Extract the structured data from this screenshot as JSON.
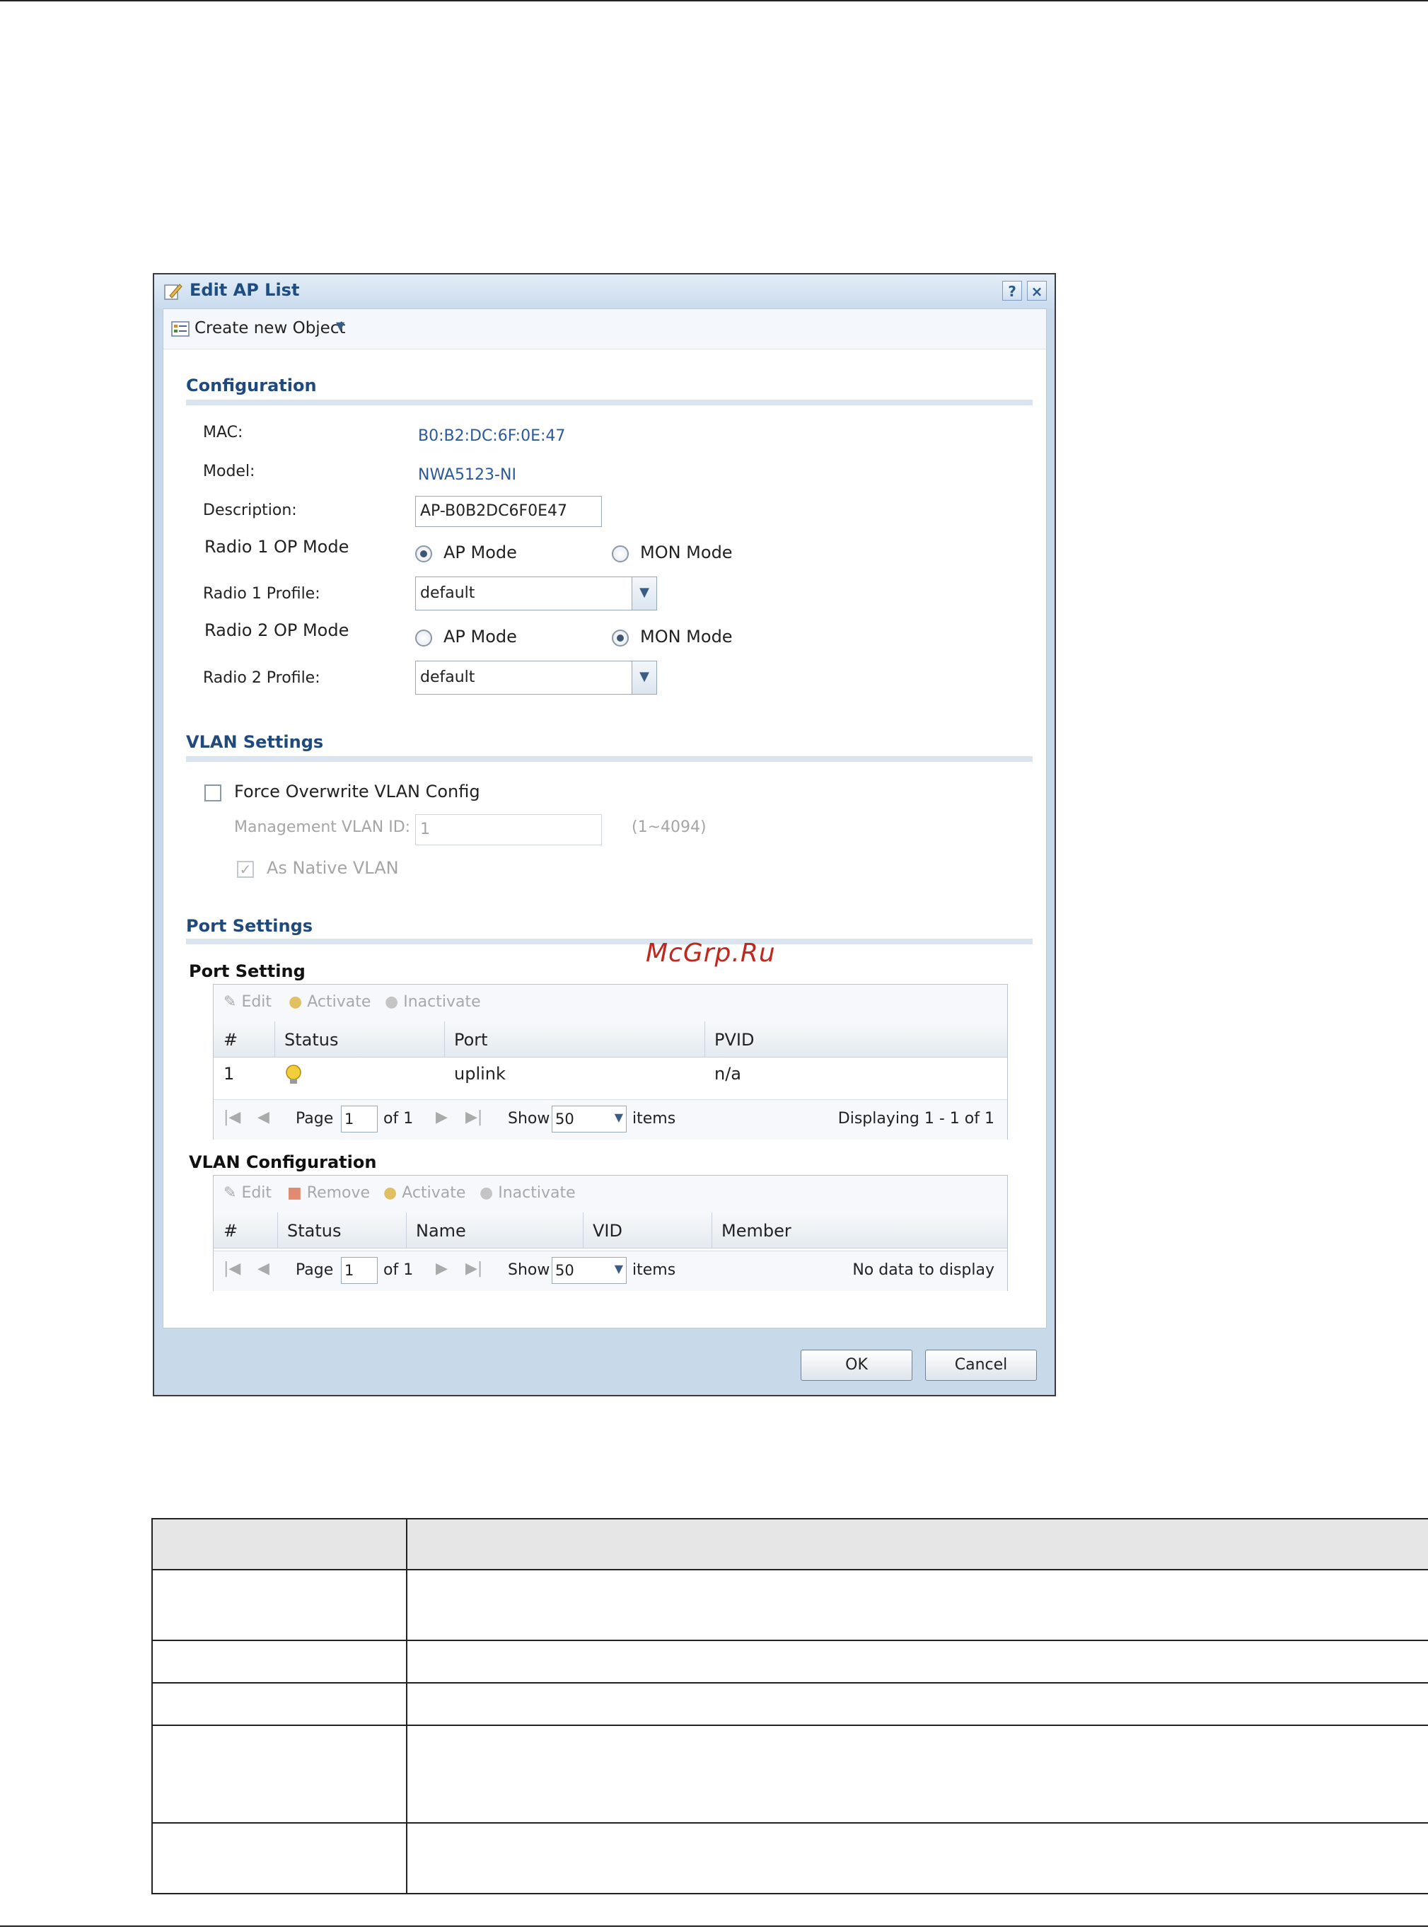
{
  "dialog": {
    "title": "Edit AP List",
    "help_label": "?",
    "close_label": "×",
    "toolbar": {
      "create_label": "Create new Object"
    },
    "configuration": {
      "heading": "Configuration",
      "mac_label": "MAC:",
      "mac_value": "B0:B2:DC:6F:0E:47",
      "model_label": "Model:",
      "model_value": "NWA5123-NI",
      "description_label": "Description:",
      "description_value": "AP-B0B2DC6F0E47",
      "radio1_mode_label": "Radio 1 OP Mode",
      "radio1_mode_ap": "AP Mode",
      "radio1_mode_mon": "MON Mode",
      "radio1_selected": "AP Mode",
      "radio1_profile_label": "Radio 1 Profile:",
      "radio1_profile_value": "default",
      "radio2_mode_label": "Radio 2 OP Mode",
      "radio2_mode_ap": "AP Mode",
      "radio2_mode_mon": "MON Mode",
      "radio2_selected": "MON Mode",
      "radio2_profile_label": "Radio 2 Profile:",
      "radio2_profile_value": "default"
    },
    "vlan_settings": {
      "heading": "VLAN Settings",
      "force_label": "Force Overwrite VLAN Config",
      "force_checked": false,
      "mgmt_vlan_label": "Management VLAN ID:",
      "mgmt_vlan_value": "1",
      "mgmt_vlan_range": "(1~4094)",
      "native_label": "As Native VLAN",
      "native_checked": true
    },
    "port_settings": {
      "heading": "Port Settings",
      "watermark": "McGrp.Ru",
      "port_setting": {
        "title": "Port Setting",
        "tools": [
          "Edit",
          "Activate",
          "Inactivate"
        ],
        "columns": [
          "#",
          "Status",
          "Port",
          "PVID"
        ],
        "rows": [
          {
            "num": "1",
            "status": "active",
            "port": "uplink",
            "pvid": "n/a"
          }
        ],
        "pager": {
          "page_label": "Page",
          "page_value": "1",
          "of_label": "of 1",
          "show_label": "Show",
          "show_value": "50",
          "items_label": "items",
          "summary": "Displaying 1 - 1 of 1"
        }
      },
      "vlan_configuration": {
        "title": "VLAN Configuration",
        "tools": [
          "Edit",
          "Remove",
          "Activate",
          "Inactivate"
        ],
        "columns": [
          "#",
          "Status",
          "Name",
          "VID",
          "Member"
        ],
        "rows": [],
        "pager": {
          "page_label": "Page",
          "page_value": "1",
          "of_label": "of 1",
          "show_label": "Show",
          "show_value": "50",
          "items_label": "items",
          "summary": "No data to display"
        }
      }
    },
    "buttons": {
      "ok": "OK",
      "cancel": "Cancel"
    }
  },
  "colors": {
    "title_text": "#1e4d82",
    "link_value": "#2a5a9a",
    "watermark": "#c0281e"
  }
}
